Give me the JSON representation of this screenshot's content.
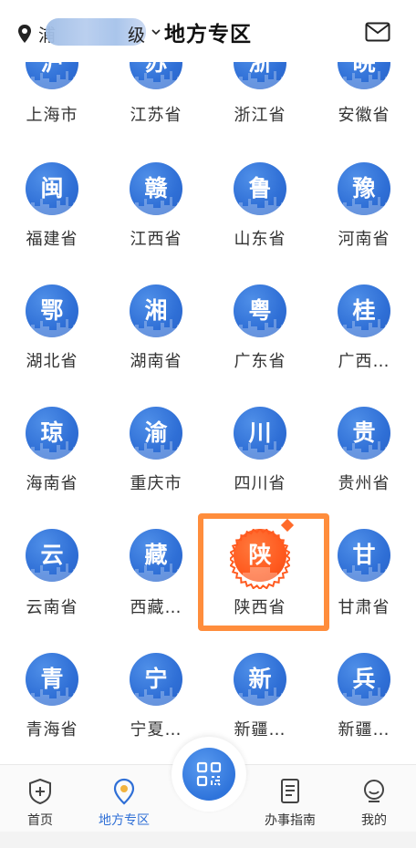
{
  "header": {
    "location_text": "浦",
    "location_suffix": "级",
    "title": "地方专区",
    "icons": [
      "location-pin-icon",
      "chevron-down-icon",
      "mail-icon"
    ]
  },
  "regions": [
    {
      "glyph": "沪",
      "name": "上海市"
    },
    {
      "glyph": "苏",
      "name": "江苏省"
    },
    {
      "glyph": "浙",
      "name": "浙江省"
    },
    {
      "glyph": "皖",
      "name": "安徽省"
    },
    {
      "glyph": "闽",
      "name": "福建省"
    },
    {
      "glyph": "赣",
      "name": "江西省"
    },
    {
      "glyph": "鲁",
      "name": "山东省"
    },
    {
      "glyph": "豫",
      "name": "河南省"
    },
    {
      "glyph": "鄂",
      "name": "湖北省"
    },
    {
      "glyph": "湘",
      "name": "湖南省"
    },
    {
      "glyph": "粤",
      "name": "广东省"
    },
    {
      "glyph": "桂",
      "name": "广西…"
    },
    {
      "glyph": "琼",
      "name": "海南省"
    },
    {
      "glyph": "渝",
      "name": "重庆市"
    },
    {
      "glyph": "川",
      "name": "四川省"
    },
    {
      "glyph": "贵",
      "name": "贵州省"
    },
    {
      "glyph": "云",
      "name": "云南省"
    },
    {
      "glyph": "藏",
      "name": "西藏…"
    },
    {
      "glyph": "陕",
      "name": "陕西省",
      "highlighted": true
    },
    {
      "glyph": "甘",
      "name": "甘肃省"
    },
    {
      "glyph": "青",
      "name": "青海省"
    },
    {
      "glyph": "宁",
      "name": "宁夏…"
    },
    {
      "glyph": "新",
      "name": "新疆…"
    },
    {
      "glyph": "兵",
      "name": "新疆…"
    }
  ],
  "colors": {
    "accent_blue": "#2f6fd6",
    "highlight_orange": "#ff8d3c",
    "active_badge": "#ff5a1f"
  },
  "nav": {
    "home": "首页",
    "local": "地方专区",
    "guide": "办事指南",
    "mine": "我的",
    "scan_icon": "qr-scan-icon"
  }
}
